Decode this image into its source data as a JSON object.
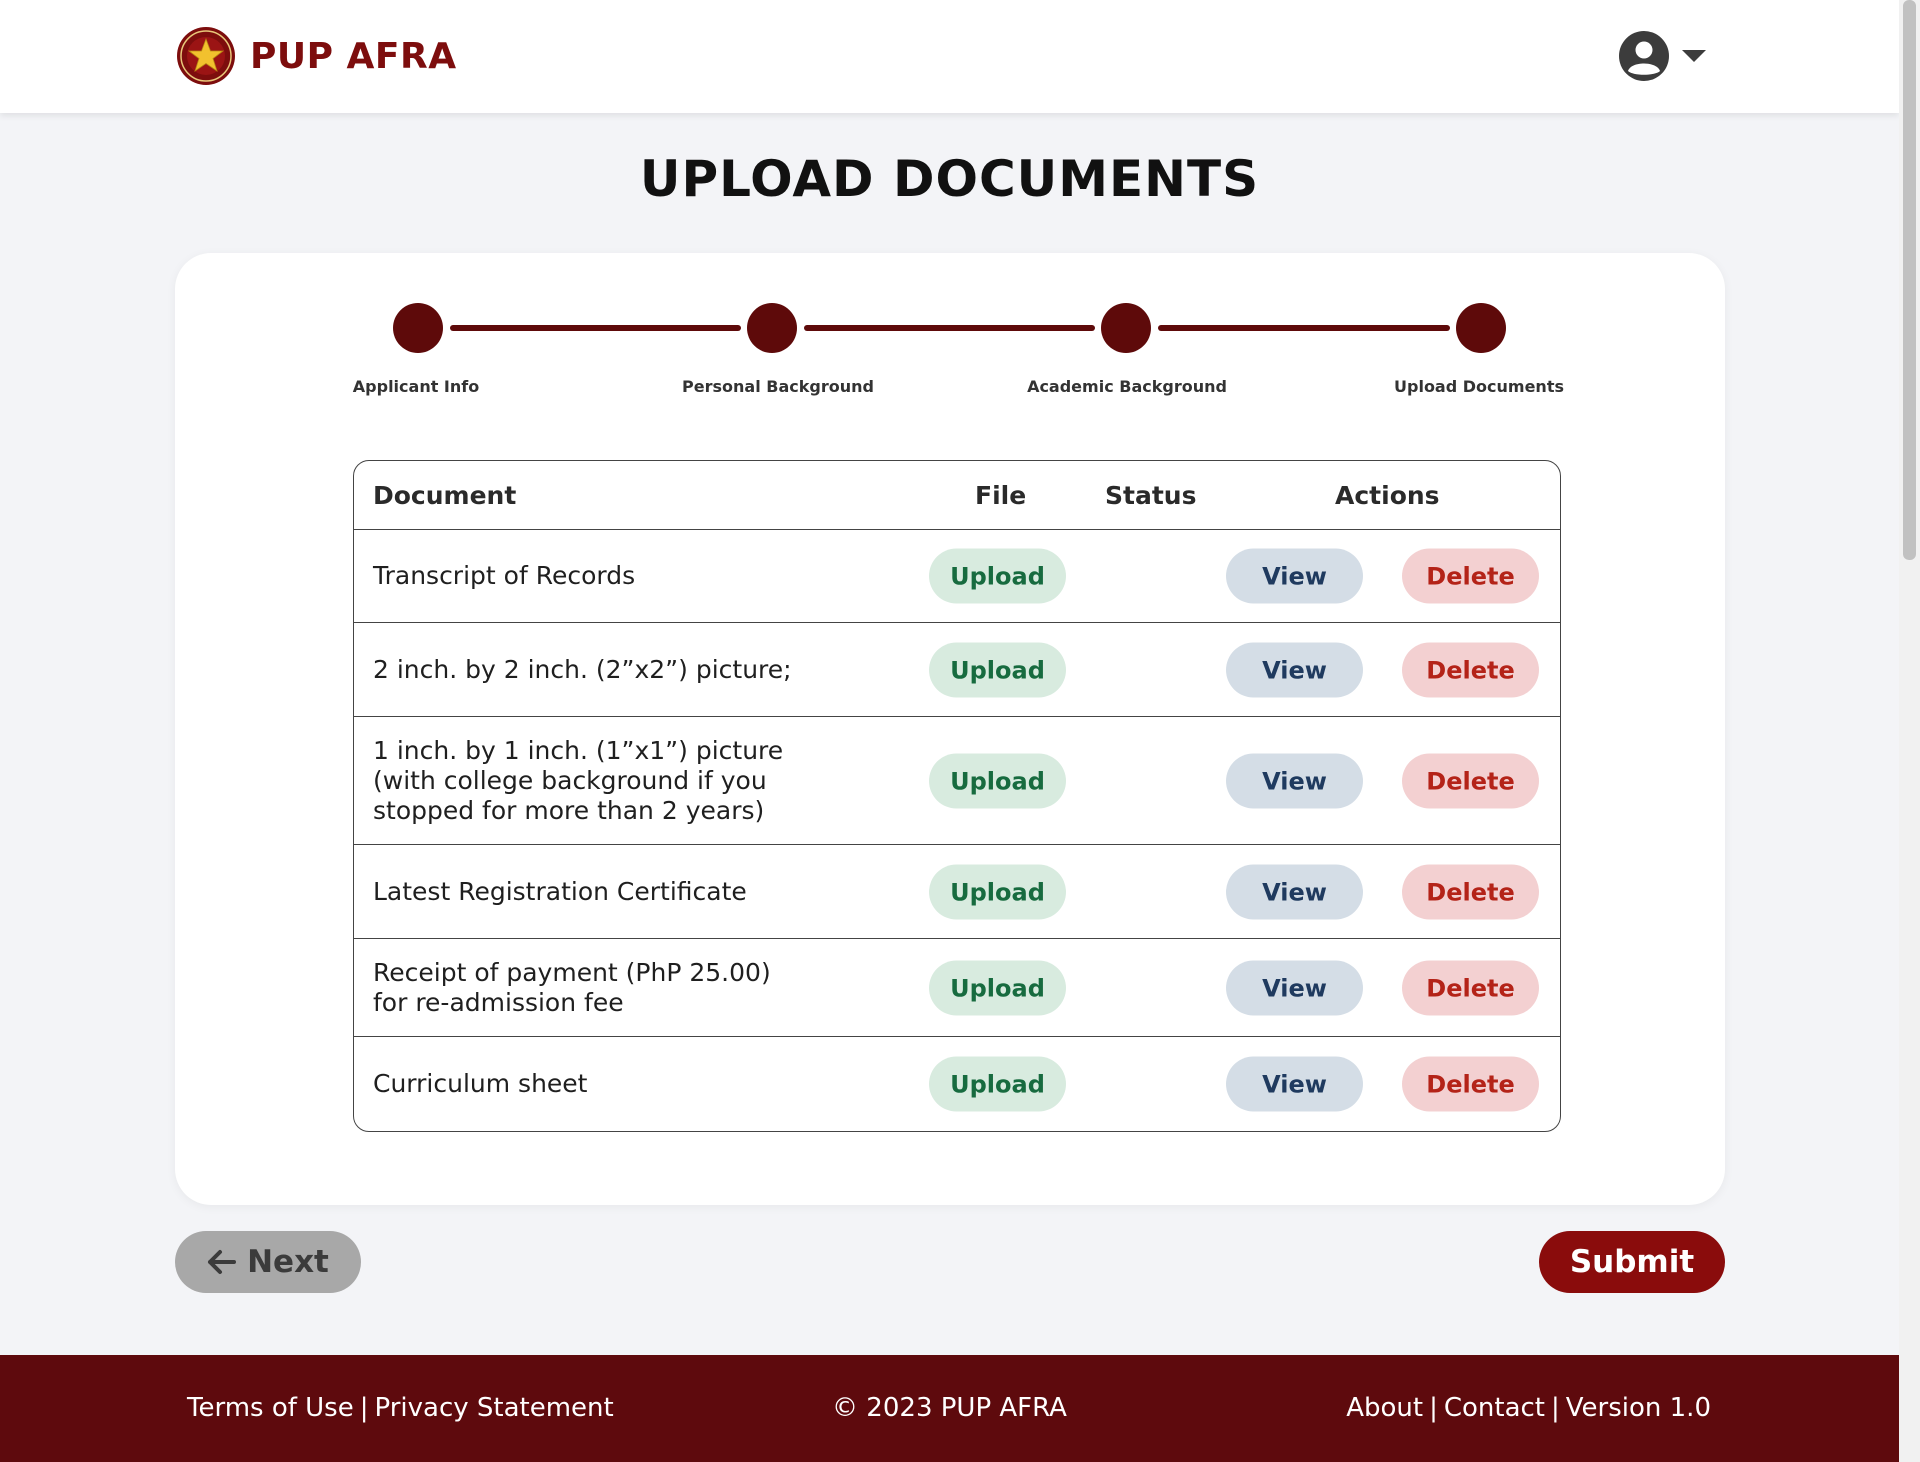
{
  "header": {
    "brand": "PUP AFRA",
    "logo_icon": "pup-seal-icon",
    "user_icon": "user-avatar-icon",
    "menu_icon": "caret-down-icon"
  },
  "page": {
    "title": "UPLOAD DOCUMENTS"
  },
  "stepper": {
    "steps": [
      {
        "label": "Applicant Info"
      },
      {
        "label": "Personal Background"
      },
      {
        "label": "Academic Background"
      },
      {
        "label": "Upload Documents"
      }
    ]
  },
  "table": {
    "headers": {
      "document": "Document",
      "file": "File",
      "status": "Status",
      "actions": "Actions"
    },
    "rows": [
      {
        "document": "Transcript of Records",
        "upload": "Upload",
        "view": "View",
        "delete": "Delete"
      },
      {
        "document": "2 inch. by 2 inch. (2”x2”) picture;",
        "upload": "Upload",
        "view": "View",
        "delete": "Delete"
      },
      {
        "document": "1 inch. by 1 inch. (1”x1”) picture (with college background if you stopped for more than 2 years)",
        "upload": "Upload",
        "view": "View",
        "delete": "Delete"
      },
      {
        "document": "Latest Registration Certificate",
        "upload": "Upload",
        "view": "View",
        "delete": "Delete"
      },
      {
        "document": "Receipt of payment (PhP 25.00) for re-admission fee",
        "upload": "Upload",
        "view": "View",
        "delete": "Delete"
      },
      {
        "document": "Curriculum sheet",
        "upload": "Upload",
        "view": "View",
        "delete": "Delete"
      }
    ]
  },
  "buttons": {
    "next": "Next",
    "submit": "Submit",
    "next_icon": "arrow-left-icon"
  },
  "footer": {
    "terms": "Terms of Use",
    "privacy": "Privacy Statement",
    "copyright": "© 2023 PUP AFRA",
    "about": "About",
    "contact": "Contact",
    "version": "Version 1.0",
    "separator": "|"
  },
  "colors": {
    "brand": "#7d0d0d",
    "stepper": "#5e0a0a",
    "footer": "#5e0a0d",
    "submit": "#8a0c0c",
    "upload_bg": "#d8ebdf",
    "view_bg": "#d4dde6",
    "delete_bg": "#f3d0d1"
  }
}
